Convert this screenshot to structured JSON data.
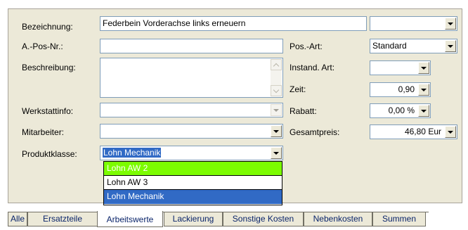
{
  "form": {
    "bezeichnung_label": "Bezeichnung:",
    "bezeichnung_value": "Federbein Vorderachse links erneuern",
    "apos_label": "A.-Pos-Nr.:",
    "apos_value": "",
    "beschreibung_label": "Beschreibung:",
    "beschreibung_value": "",
    "werkstattinfo_label": "Werkstattinfo:",
    "werkstattinfo_value": "",
    "mitarbeiter_label": "Mitarbeiter:",
    "mitarbeiter_value": "",
    "produktklasse_label": "Produktklasse:",
    "produktklasse_value": "Lohn Mechanik",
    "posart_label": "Pos.-Art:",
    "posart_value": "Standard",
    "instand_label": "Instand. Art:",
    "instand_value": "",
    "zeit_label": "Zeit:",
    "zeit_value": "0,90",
    "rabatt_label": "Rabatt:",
    "rabatt_value": "0,00 %",
    "gesamtpreis_label": "Gesamtpreis:",
    "gesamtpreis_value": "46,80 Eur",
    "bezeichnung_extra_value": ""
  },
  "dropdown": {
    "options": [
      "Lohn AW 2",
      "Lohn AW 3",
      "Lohn Mechanik"
    ]
  },
  "tabs": [
    "Alle",
    "Ersatzteile",
    "Arbeitswerte",
    "Lackierung",
    "Sonstige Kosten",
    "Nebenkosten",
    "Summen"
  ],
  "active_tab": "Arbeitswerte"
}
